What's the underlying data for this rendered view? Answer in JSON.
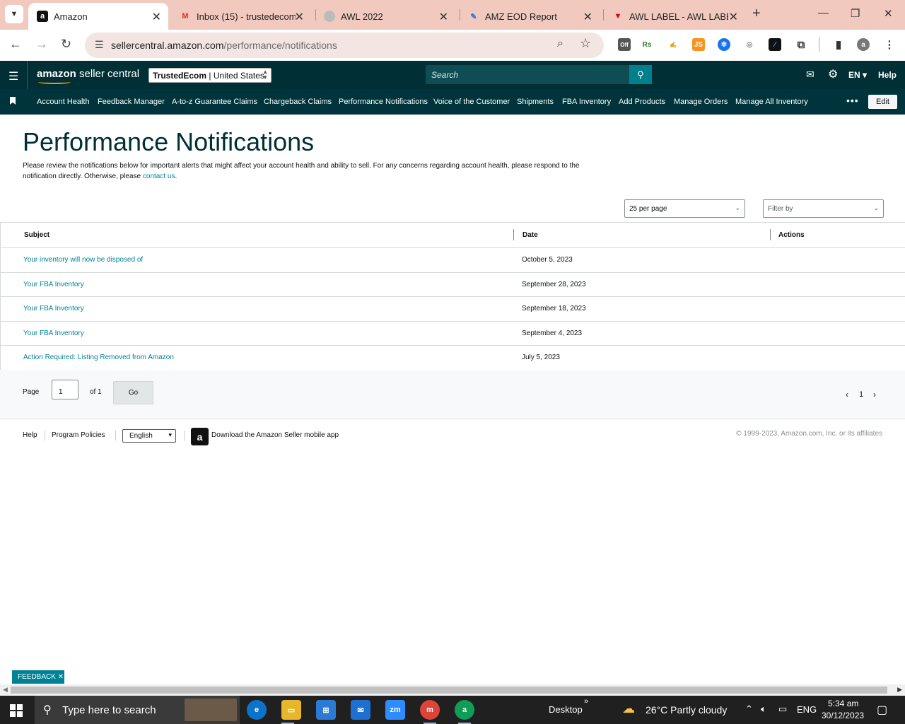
{
  "browser": {
    "tabs": [
      {
        "title": "Amazon",
        "active": true
      },
      {
        "title": "Inbox (15) - trustedecom",
        "active": false
      },
      {
        "title": "AWL 2022",
        "active": false
      },
      {
        "title": "AMZ EOD Report",
        "active": false
      },
      {
        "title": "AWL LABEL - AWL LABEL",
        "active": false
      }
    ],
    "url_host": "sellercentral.amazon.com",
    "url_path": "/performance/notifications",
    "extension_off_badge": "Off"
  },
  "header": {
    "logo_bold": "amazon",
    "logo_rest": " seller central",
    "store_company": "TrustedEcom",
    "store_sep": " | ",
    "store_country": "United States",
    "search_placeholder": "Search",
    "language": "EN",
    "help": "Help"
  },
  "nav": {
    "links": [
      "Account Health",
      "Feedback Manager",
      "A-to-z Guarantee Claims",
      "Chargeback Claims",
      "Performance Notifications",
      "Voice of the Customer",
      "Shipments",
      "FBA Inventory",
      "Add Products",
      "Manage Orders",
      "Manage All Inventory"
    ],
    "edit": "Edit"
  },
  "main": {
    "title": "Performance Notifications",
    "intro": "Please review the notifications below for important alerts that might affect your account health and ability to sell. For any concerns regarding account health, please respond to the notification directly. Otherwise, please ",
    "contact_link": "contact us",
    "intro_end": ".",
    "per_page": "25 per page",
    "filter_placeholder": "Filter by",
    "columns": {
      "subject": "Subject",
      "date": "Date",
      "actions": "Actions"
    },
    "rows": [
      {
        "subject": "Your inventory will now be disposed of",
        "date": "October 5, 2023"
      },
      {
        "subject": "Your FBA Inventory",
        "date": "September 28, 2023"
      },
      {
        "subject": "Your FBA Inventory",
        "date": "September 18, 2023"
      },
      {
        "subject": "Your FBA Inventory",
        "date": "September 4, 2023"
      },
      {
        "subject": "Action Required: Listing Removed from Amazon",
        "date": "July 5, 2023"
      }
    ],
    "pager": {
      "page_label": "Page",
      "page_value": "1",
      "of_label": "of 1",
      "go": "Go",
      "current": "1"
    }
  },
  "footer": {
    "help": "Help",
    "policies": "Program Policies",
    "language": "English",
    "app": "Download the Amazon Seller mobile app",
    "copyright": "© 1999-2023, Amazon.com, Inc. or its affiliates"
  },
  "feedback": "FEEDBACK",
  "taskbar": {
    "search_placeholder": "Type here to search",
    "desktop": "Desktop",
    "weather": "26°C  Partly cloudy",
    "lang": "ENG",
    "time": "5:34 am",
    "date": "30/12/2023"
  }
}
